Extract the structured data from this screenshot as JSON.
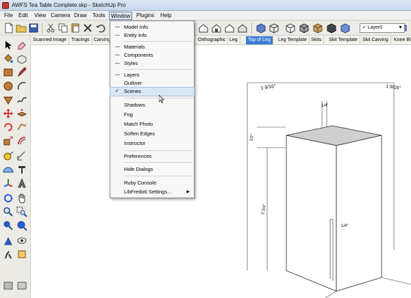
{
  "window": {
    "title": "AWFS Tea Table Complete.skp - SketchUp Pro"
  },
  "menubar": [
    {
      "label": "File"
    },
    {
      "label": "Edit"
    },
    {
      "label": "View"
    },
    {
      "label": "Camera"
    },
    {
      "label": "Draw"
    },
    {
      "label": "Tools"
    },
    {
      "label": "Window"
    },
    {
      "label": "Plugins"
    },
    {
      "label": "Help"
    }
  ],
  "layer_dropdown": {
    "check": "✓",
    "value": "Layer0"
  },
  "scene_tabs": [
    {
      "label": "Scanned Image"
    },
    {
      "label": "Tracings"
    },
    {
      "label": "Carving"
    },
    {
      "label": "Orthographic"
    },
    {
      "label": "Leg"
    },
    {
      "label": "Top of Leg",
      "active": true
    },
    {
      "label": "Leg Template"
    },
    {
      "label": "Skits"
    },
    {
      "label": "Skit Template"
    },
    {
      "label": "Skit Carving"
    },
    {
      "label": "Knee Bl"
    }
  ],
  "window_menu": {
    "items": [
      {
        "label": "Model Info",
        "mark": "dash"
      },
      {
        "label": "Entity Info",
        "mark": "dash"
      },
      {
        "label": "Materials",
        "mark": "dash"
      },
      {
        "label": "Components",
        "mark": "dash"
      },
      {
        "label": "Styles",
        "mark": "dash"
      },
      {
        "label": "Layers",
        "mark": "dash"
      },
      {
        "label": "Outliner",
        "mark": ""
      },
      {
        "label": "Scenes",
        "mark": "check",
        "highlighted": true
      },
      {
        "label": "Shadows",
        "mark": ""
      },
      {
        "label": "Fog",
        "mark": ""
      },
      {
        "label": "Match Photo",
        "mark": ""
      },
      {
        "label": "Soften Edges",
        "mark": ""
      },
      {
        "label": "Instructor",
        "mark": ""
      },
      {
        "label": "Preferences",
        "mark": ""
      },
      {
        "label": "Hide Dialogs",
        "mark": ""
      },
      {
        "label": "Ruby Console",
        "mark": ""
      },
      {
        "label": "LibFredo6 Settings...",
        "mark": "",
        "submenu": true
      }
    ],
    "check_glyph": "✓",
    "dash_glyph": "—"
  },
  "dimensions": {
    "top_left": "1 9/16\"",
    "top_right": "1 9/16\"",
    "top_center": "1/4\"",
    "left_upper": "1/2\"",
    "left_lower": "2 3/4\"",
    "inner_right": "1/4\""
  },
  "icons": {
    "toolbar": [
      "new-file-icon",
      "open-folder-icon",
      "save-icon",
      "cut-icon",
      "copy-icon",
      "paste-icon",
      "erase-icon",
      "undo-icon",
      "redo-icon",
      "print-icon",
      "model-info-icon",
      "iso-view-icon",
      "top-view-icon",
      "front-view-icon",
      "right-view-icon",
      "back-view-icon",
      "left-view-icon",
      "xray-style-icon",
      "wireframe-style-icon",
      "hidden-line-style-icon",
      "shaded-style-icon",
      "textured-style-icon",
      "monochrome-style-icon",
      "layers-icon"
    ]
  },
  "colors": {
    "active_tab": "#3f7fd6",
    "menu_highlight": "#dae6f5",
    "model_top": "#cfcfcf"
  }
}
